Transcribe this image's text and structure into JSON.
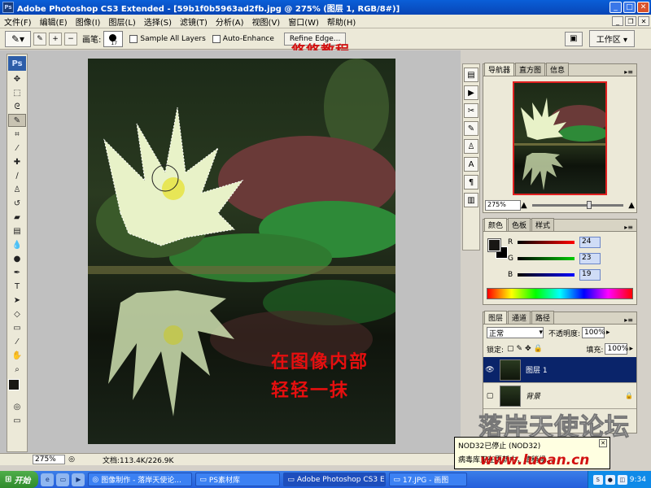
{
  "window": {
    "title": "Adobe Photoshop CS3 Extended - [59b1f0b5963ad2fb.jpg @ 275% (图层 1, RGB/8#)]",
    "app_icon": "Ps"
  },
  "menu": {
    "items": [
      "文件(F)",
      "编辑(E)",
      "图像(I)",
      "图层(L)",
      "选择(S)",
      "滤镜(T)",
      "分析(A)",
      "视图(V)",
      "窗口(W)",
      "帮助(H)"
    ]
  },
  "options": {
    "brush_label": "画笔:",
    "brush_size": "17",
    "sample_all_layers": "Sample All Layers",
    "auto_enhance": "Auto-Enhance",
    "refine_edge": "Refine Edge...",
    "workspace": "工作区 ▾"
  },
  "watermark_top": "悠悠教程",
  "canvas": {
    "annotation_line1": "在图像内部",
    "annotation_line2": "轻轻一抹"
  },
  "toolbox": {
    "logo": "Ps",
    "tools": [
      "move-icon",
      "marquee-icon",
      "lasso-icon",
      "quick-select-icon",
      "crop-icon",
      "eyedropper-icon",
      "healing-icon",
      "brush-icon",
      "stamp-icon",
      "history-brush-icon",
      "eraser-icon",
      "gradient-icon",
      "blur-icon",
      "dodge-icon",
      "pen-icon",
      "type-icon",
      "path-select-icon",
      "shape-icon",
      "notes-icon",
      "eyedropper2-icon",
      "hand-icon",
      "zoom-icon"
    ]
  },
  "navigator": {
    "tabs": [
      "导航器",
      "直方图",
      "信息"
    ],
    "zoom": "275%"
  },
  "color": {
    "tabs": [
      "颜色",
      "色板",
      "样式"
    ],
    "channels": [
      {
        "label": "R",
        "value": "24",
        "color": "#d01818"
      },
      {
        "label": "G",
        "value": "23",
        "color": "#18a018"
      },
      {
        "label": "B",
        "value": "19",
        "color": "#1830c0"
      }
    ],
    "foreground": "#181713"
  },
  "layers": {
    "tabs": [
      "图层",
      "通道",
      "路径"
    ],
    "blend_mode": "正常",
    "opacity_label": "不透明度:",
    "opacity": "100%",
    "lock_label": "锁定:",
    "fill_label": "填充:",
    "fill": "100%",
    "items": [
      {
        "name": "图层 1",
        "selected": true
      },
      {
        "name": "背景",
        "selected": false
      }
    ]
  },
  "status": {
    "zoom": "275%",
    "doc": "文档:113.4K/226.9K"
  },
  "tooltip": {
    "line1": "NOD32已停止 (NOD32)",
    "line2": "病毒库正在更新中，请稍候..."
  },
  "site_watermark": "www.luoan.cn",
  "big_watermark": "落岸天使论坛",
  "taskbar": {
    "start": "开始",
    "tasks": [
      "图像制作 - 落岸天使论...",
      "PS素材库",
      "Adobe Photoshop CS3 E...",
      "17.JPG - 画图"
    ],
    "clock": "9:34"
  }
}
